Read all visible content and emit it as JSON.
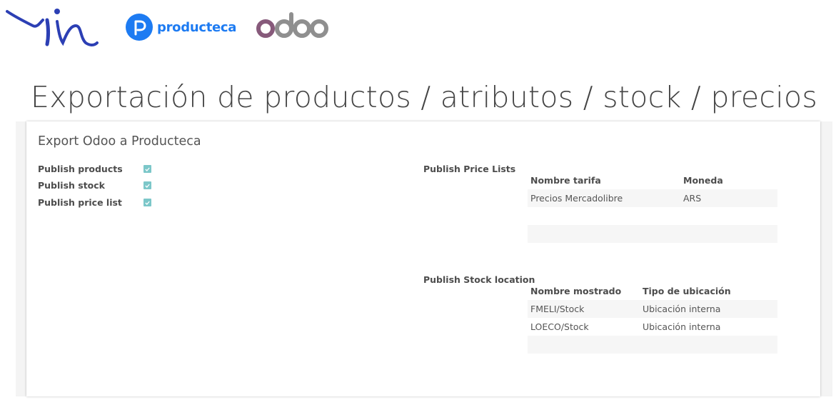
{
  "header": {
    "brand_producteca": "producteca",
    "brand_odoo": "odoo",
    "headline": "Exportación de productos / atributos / stock / precios"
  },
  "form": {
    "title": "Export Odoo a Producteca",
    "flags": [
      {
        "label": "Publish products",
        "checked": true
      },
      {
        "label": "Publish stock",
        "checked": true
      },
      {
        "label": "Publish price list",
        "checked": true
      }
    ],
    "price_lists": {
      "label": "Publish Price Lists",
      "columns": [
        "Nombre tarifa",
        "Moneda"
      ],
      "rows": [
        [
          "Precios Mercadolibre",
          "ARS"
        ]
      ]
    },
    "stock_locations": {
      "label": "Publish Stock location",
      "columns": [
        "Nombre mostrado",
        "Tipo de ubicación"
      ],
      "rows": [
        [
          "FMELI/Stock",
          "Ubicación interna"
        ],
        [
          "LOECO/Stock",
          "Ubicación interna"
        ]
      ]
    }
  },
  "colors": {
    "checkbox": "#7cc7c9",
    "producteca_blue": "#1d7bf2",
    "odoo_purple": "#875a7b",
    "odoo_gray": "#8f8f8f"
  }
}
